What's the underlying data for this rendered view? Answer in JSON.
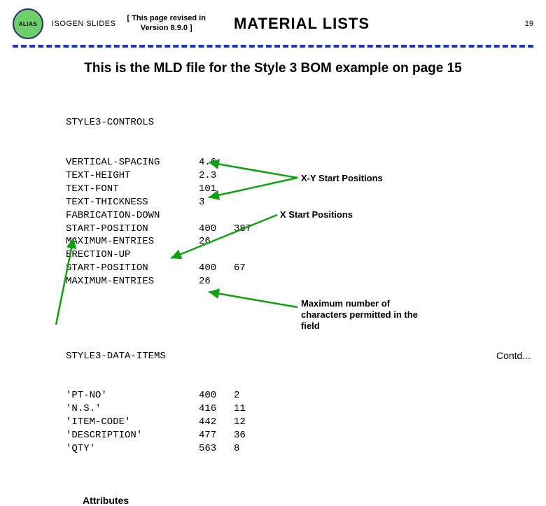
{
  "header": {
    "logo": "ALIAS",
    "product": "ISOGEN SLIDES",
    "revision_line1": "[ This page revised in",
    "revision_line2": "Version 8.9.0 ]",
    "title": "MATERIAL LISTS",
    "page_number": "19"
  },
  "subheading": "This is the MLD file for the Style 3 BOM example on page 15",
  "block1": {
    "header": "STYLE3-CONTROLS",
    "rows": [
      {
        "key": "VERTICAL-SPACING",
        "v1": "4.6",
        "v2": ""
      },
      {
        "key": "TEXT-HEIGHT",
        "v1": "2.3",
        "v2": ""
      },
      {
        "key": "TEXT-FONT",
        "v1": "101",
        "v2": ""
      },
      {
        "key": "TEXT-THICKNESS",
        "v1": "3",
        "v2": ""
      },
      {
        "key": "FABRICATION-DOWN",
        "v1": "",
        "v2": ""
      },
      {
        "key": "START-POSITION",
        "v1": "400",
        "v2": "387"
      },
      {
        "key": "MAXIMUM-ENTRIES",
        "v1": "26",
        "v2": ""
      },
      {
        "key": "ERECTION-UP",
        "v1": "",
        "v2": ""
      },
      {
        "key": "START-POSITION",
        "v1": "400",
        "v2": "67"
      },
      {
        "key": "MAXIMUM-ENTRIES",
        "v1": "26",
        "v2": ""
      }
    ]
  },
  "block2": {
    "header": "STYLE3-DATA-ITEMS",
    "rows": [
      {
        "key": "'PT-NO'",
        "v1": "400",
        "v2": "2"
      },
      {
        "key": "'N.S.'",
        "v1": "416",
        "v2": "11"
      },
      {
        "key": "'ITEM-CODE'",
        "v1": "442",
        "v2": "12"
      },
      {
        "key": "'DESCRIPTION'",
        "v1": "477",
        "v2": "36"
      },
      {
        "key": "'QTY'",
        "v1": "563",
        "v2": "8"
      }
    ]
  },
  "labels": {
    "attributes": "Attributes",
    "xy_pos": "X-Y Start Positions",
    "x_pos": "X Start Positions",
    "max_chars": "Maximum number of characters permitted in the field",
    "contd": "Contd..."
  }
}
